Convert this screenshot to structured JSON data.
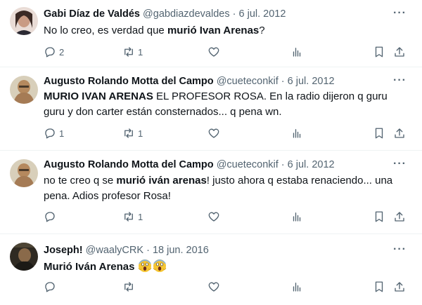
{
  "tweets": [
    {
      "name": "Gabi Díaz de Valdés",
      "handle": "@gabdiazdevaldes",
      "sep": "·",
      "date": "6 jul. 2012",
      "text_pre": "No lo creo, es verdad que ",
      "text_bold": "murió Ivan Arenas",
      "text_post": "?",
      "replies": "2",
      "retweets": "1"
    },
    {
      "name": "Augusto Rolando Motta del Campo",
      "handle": "@cueteconkif",
      "sep": "·",
      "date": "6 jul. 2012",
      "text_bold": "MURIO IVAN ARENAS",
      "text_post": " EL PROFESOR ROSA. En la radio dijeron q guru guru y don carter están consternados... q pena wn.",
      "replies": "1",
      "retweets": "1"
    },
    {
      "name": "Augusto Rolando Motta del Campo",
      "handle": "@cueteconkif",
      "sep": "·",
      "date": "6 jul. 2012",
      "text_pre": "no te creo q se ",
      "text_bold": "murió iván arenas",
      "text_post": "! justo ahora q estaba renaciendo... una pena. Adios profesor Rosa!",
      "retweets": "1"
    },
    {
      "name": "Joseph!",
      "handle": "@waalyCRK",
      "sep": "·",
      "date": "18 jun. 2016",
      "text_bold": "Murió Iván Arenas",
      "emoji": [
        "screaming-face",
        "screaming-face"
      ]
    }
  ],
  "more_glyph": "···",
  "colors": {
    "text": "#0f1419",
    "muted": "#536471",
    "divider": "#eff3f4"
  },
  "icons": [
    "reply-icon",
    "retweet-icon",
    "like-icon",
    "views-icon",
    "bookmark-icon",
    "share-icon"
  ]
}
